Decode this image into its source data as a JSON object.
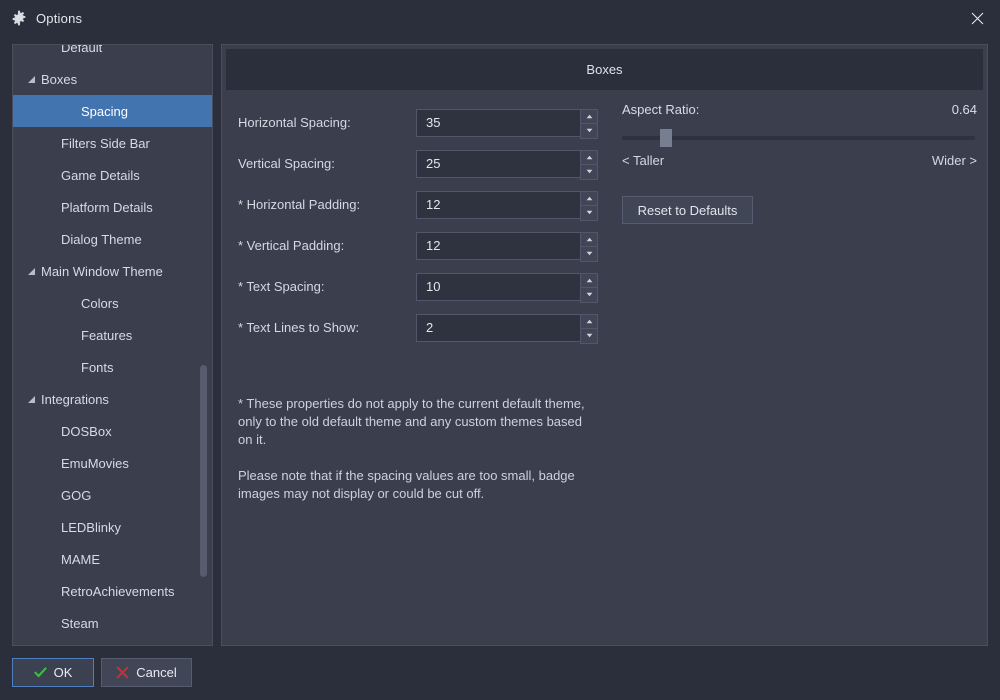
{
  "window": {
    "title": "Options",
    "icon": "gear-icon",
    "close_icon": "close-icon"
  },
  "sidebar": {
    "items": [
      {
        "label": "Default",
        "level": 1,
        "expander": "none",
        "selected": false
      },
      {
        "label": "Boxes",
        "level": 0,
        "expander": "expanded",
        "selected": false
      },
      {
        "label": "Spacing",
        "level": 2,
        "expander": "none",
        "selected": true
      },
      {
        "label": "Filters Side Bar",
        "level": 1,
        "expander": "none",
        "selected": false
      },
      {
        "label": "Game Details",
        "level": 1,
        "expander": "none",
        "selected": false
      },
      {
        "label": "Platform Details",
        "level": 1,
        "expander": "none",
        "selected": false
      },
      {
        "label": "Dialog Theme",
        "level": 1,
        "expander": "none",
        "selected": false
      },
      {
        "label": "Main Window Theme",
        "level": 0,
        "expander": "expanded",
        "selected": false
      },
      {
        "label": "Colors",
        "level": 2,
        "expander": "none",
        "selected": false
      },
      {
        "label": "Features",
        "level": 2,
        "expander": "none",
        "selected": false
      },
      {
        "label": "Fonts",
        "level": 2,
        "expander": "none",
        "selected": false
      },
      {
        "label": "Integrations",
        "level": 0,
        "expander": "expanded",
        "selected": false
      },
      {
        "label": "DOSBox",
        "level": 1,
        "expander": "none",
        "selected": false
      },
      {
        "label": "EmuMovies",
        "level": 1,
        "expander": "none",
        "selected": false
      },
      {
        "label": "GOG",
        "level": 1,
        "expander": "none",
        "selected": false
      },
      {
        "label": "LEDBlinky",
        "level": 1,
        "expander": "none",
        "selected": false
      },
      {
        "label": "MAME",
        "level": 1,
        "expander": "none",
        "selected": false
      },
      {
        "label": "RetroAchievements",
        "level": 1,
        "expander": "none",
        "selected": false
      },
      {
        "label": "Steam",
        "level": 1,
        "expander": "none",
        "selected": false
      }
    ]
  },
  "panel": {
    "header": "Boxes",
    "fields": [
      {
        "label": "Horizontal Spacing:",
        "value": "35"
      },
      {
        "label": "Vertical Spacing:",
        "value": "25"
      },
      {
        "label": "* Horizontal Padding:",
        "value": "12"
      },
      {
        "label": "* Vertical Padding:",
        "value": "12"
      },
      {
        "label": "* Text Spacing:",
        "value": "10"
      },
      {
        "label": "* Text Lines to Show:",
        "value": "2"
      }
    ],
    "notes": [
      "* These properties do not apply to the current default theme, only to the old default theme and any custom themes based on it.",
      "Please note that if the spacing values are too small, badge images may not display or could be cut off."
    ],
    "aspect_ratio": {
      "label": "Aspect Ratio:",
      "value": "0.64",
      "left_end": "< Taller",
      "right_end": "Wider >"
    },
    "reset_button": "Reset to Defaults"
  },
  "footer": {
    "ok": "OK",
    "cancel": "Cancel"
  },
  "colors": {
    "window_bg": "#2b2e3b",
    "panel_bg": "#3a3e4d",
    "selection": "#4274b0",
    "input_bg": "#2f323f",
    "focus_border": "#4f7fbf",
    "ok_check": "#3fbf3f",
    "cancel_x": "#cc2d33"
  }
}
